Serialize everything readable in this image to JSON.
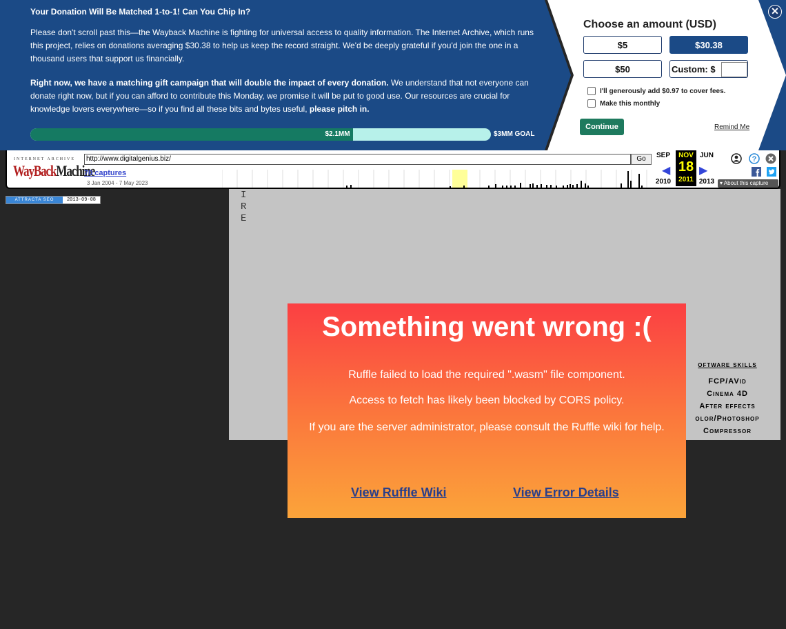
{
  "donation": {
    "title": "Your Donation Will Be Matched 1-to-1! Can You Chip In?",
    "para1": "Please don't scroll past this—the Wayback Machine is fighting for universal access to quality information. The Internet Archive, which runs this project, relies on donations averaging $30.38 to help us keep the record straight. We'd be deeply grateful if you'd join the one in a thousand users that support us financially.",
    "para2_bold": "Right now, we have a matching gift campaign that will double the impact of every donation.",
    "para2_rest": " We understand that not everyone can donate right now, but if you can afford to contribute this Monday, we promise it will be put to good use. Our resources are crucial for knowledge lovers everywhere—so if you find all these bits and bytes useful, ",
    "para2_end": "please pitch in.",
    "progress_label": "$2.1MM",
    "progress_fraction": 0.7,
    "goal_label": "$3MM GOAL",
    "choose_title": "Choose an amount (USD)",
    "amounts": {
      "a5": "$5",
      "a30": "$30.38",
      "a50": "$50",
      "custom": "Custom: $"
    },
    "custom_value": "",
    "fee_label": "I'll generously add $0.97 to cover fees.",
    "monthly_label": "Make this monthly",
    "continue_label": "Continue",
    "remind_label": "Remind Me",
    "close_glyph": "✕",
    "colors": {
      "banner": "#1b4a86",
      "panel": "#ffffff",
      "accent": "#1e7a5e"
    }
  },
  "wayback": {
    "logo_top": "INTERNET ARCHIVE",
    "logo_way": "WayBack",
    "logo_machine": "Machine",
    "url": "http://www.digitalgenius.biz/",
    "go_label": "Go",
    "captures": "70 captures",
    "range": "3 Jan 2004 - 7 May 2023",
    "prev_month": "SEP",
    "cur_month": "NOV",
    "next_month": "JUN",
    "cur_day": "18",
    "prev_year": "2010",
    "cur_year": "2011",
    "next_year": "2013",
    "about": "About this capture"
  },
  "attracta": {
    "label": "ATTRACTA SEO",
    "date": "2013-09-08"
  },
  "flash_letters": "I\nR\nE",
  "skills": {
    "heading": "oftware skills",
    "items": [
      "FCP/AVid",
      "Cinema 4D",
      "After effects",
      "olor/Photoshop",
      "Compressor"
    ]
  },
  "ruffle": {
    "title": "Something went wrong :(",
    "msg1": "Ruffle failed to load the required \".wasm\" file component.",
    "msg2": "Access to fetch has likely been blocked by CORS policy.",
    "msg3": "If you are the server administrator, please consult the Ruffle wiki for help.",
    "link_wiki": "View Ruffle Wiki",
    "link_details": "View Error Details"
  }
}
